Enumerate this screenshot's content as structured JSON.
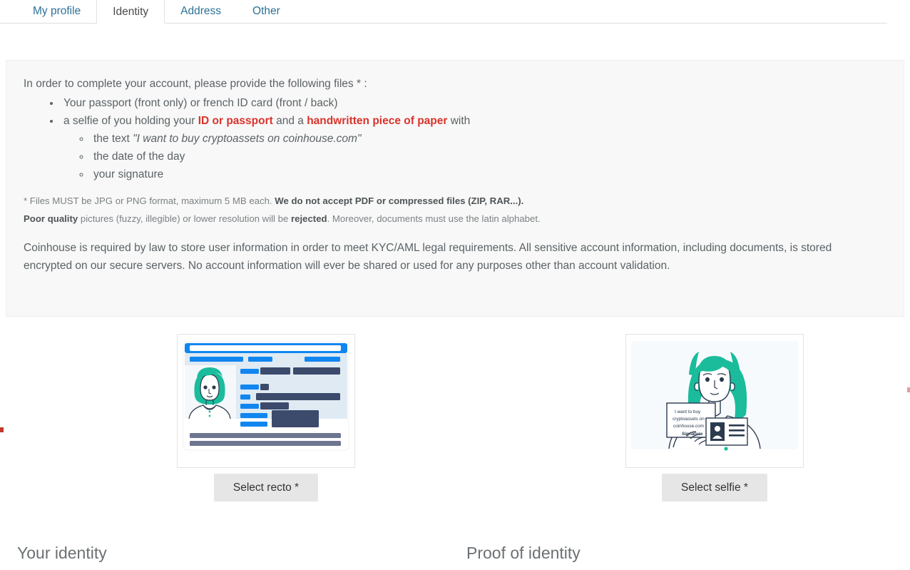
{
  "tabs": [
    {
      "label": "My profile",
      "active": false
    },
    {
      "label": "Identity",
      "active": true
    },
    {
      "label": "Address",
      "active": false
    },
    {
      "label": "Other",
      "active": false
    }
  ],
  "info": {
    "lead": "In order to complete your account, please provide the following files * :",
    "bullet1": "Your passport (front only) or french ID card (front / back)",
    "bullet2": {
      "pre": "a selfie of you holding your ",
      "red1": "ID or passport",
      "mid": " and a ",
      "red2": "handwritten piece of paper",
      "post": " with"
    },
    "subbullets": [
      {
        "pre": "the text ",
        "quote": "\"I want to buy cryptoassets on coinhouse.com\""
      },
      {
        "pre": "the date of the day",
        "quote": ""
      },
      {
        "pre": "your signature",
        "quote": ""
      }
    ],
    "note1": {
      "normal": "* Files MUST be JPG or PNG format, maximum 5 MB each. ",
      "bold": "We do not accept PDF or compressed files (ZIP, RAR...)."
    },
    "note2": {
      "bold1": "Poor quality",
      "mid": " pictures (fuzzy, illegible) or lower resolution will be ",
      "bold2": "rejected",
      "tail": ". Moreover, documents must use the latin alphabet."
    },
    "paragraph": "Coinhouse is required by law to store user information in order to meet KYC/AML legal requirements. All sensitive account information, including documents, is stored encrypted on our secure servers. No account information will ever be shared or used for any purposes other than account validation."
  },
  "uploads": {
    "recto": {
      "button_label": "Select recto *",
      "illustration_name": "id-card-illustration"
    },
    "selfie": {
      "button_label": "Select selfie *",
      "illustration_name": "selfie-with-id-illustration",
      "paper_lines": [
        "I want to buy",
        "cryptoassets on",
        "coinhouse.com"
      ],
      "paper_signature": "Signature"
    }
  },
  "headings": {
    "left": "Your identity",
    "right": "Proof of identity"
  },
  "colors": {
    "tab_link": "#2c7296",
    "accent_red": "#d9332c",
    "panel_bg": "#f8f8f8",
    "text": "#5b6266",
    "illus_teal": "#1abc9c",
    "illus_blue": "#1186f0",
    "illus_navy": "#3c4a6b",
    "button_bg": "#e6e6e6"
  }
}
